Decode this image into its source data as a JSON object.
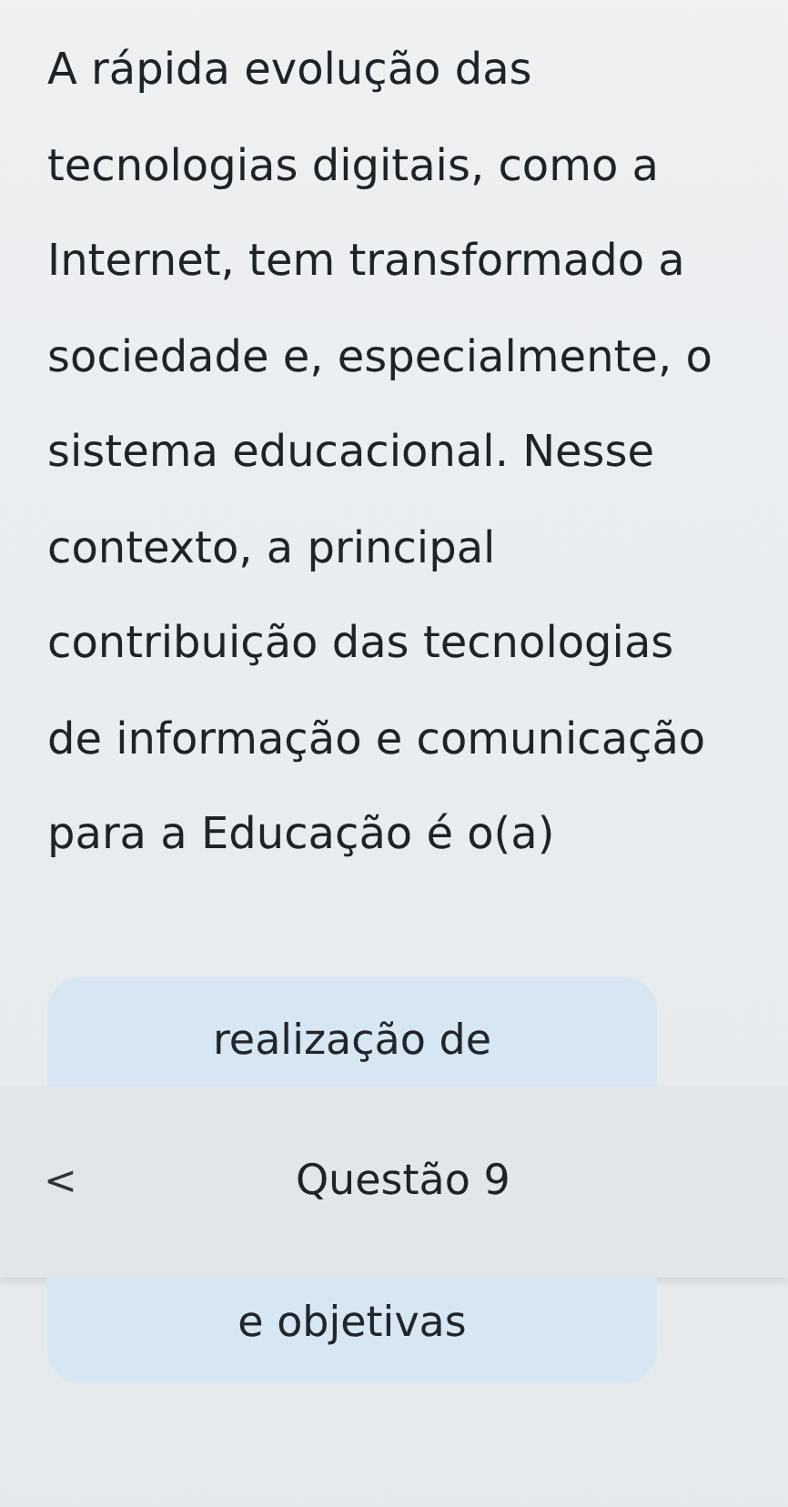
{
  "question": {
    "text": "A rápida evolução das tecnologias digitais, como a Internet, tem transformado a sociedade e, especialmente, o sistema educacional. Nesse contexto, a principal contribuição das tecnologias de informação e comunicação para a Educação é o(a)"
  },
  "option_card": {
    "top_text": "realização de",
    "bottom_text": "e objetivas"
  },
  "header": {
    "back": "<",
    "title": "Questão 9"
  }
}
